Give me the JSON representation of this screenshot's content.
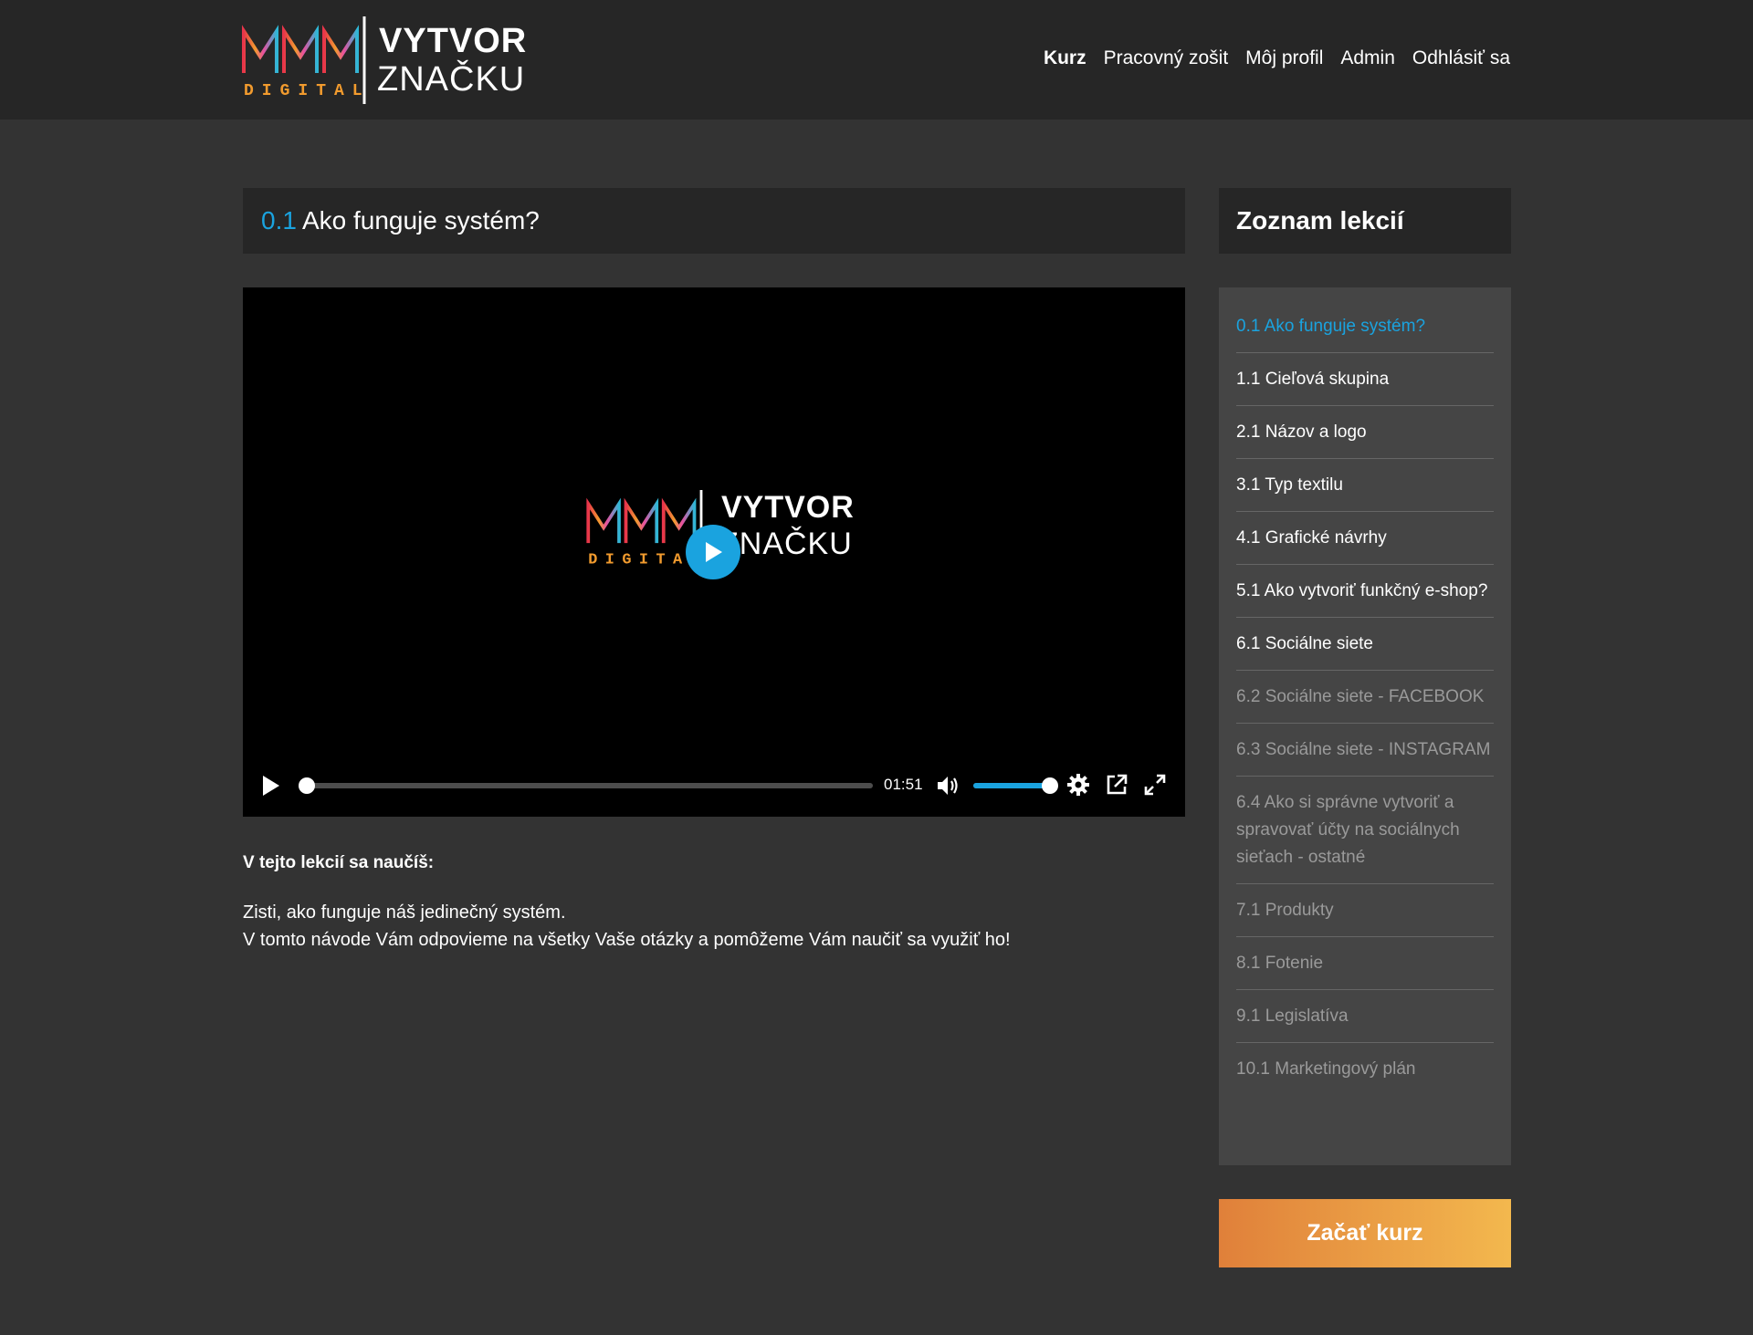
{
  "header": {
    "logo": {
      "mark_letters": "DIGITAL",
      "word1": "VYTVOR",
      "word2": "ZNAČKU"
    },
    "nav": [
      {
        "label": "Kurz",
        "active": true
      },
      {
        "label": "Pracovný zošit",
        "active": false
      },
      {
        "label": "Môj profil",
        "active": false
      },
      {
        "label": "Admin",
        "active": false
      },
      {
        "label": "Odhlásiť sa",
        "active": false
      }
    ]
  },
  "lesson": {
    "number": "0.1",
    "title": "Ako funguje systém?"
  },
  "video": {
    "overlay_logo": {
      "mark_letters": "DIGITAL",
      "word1": "VYTVOR",
      "word2": "ZNAČKU"
    },
    "time": "01:51",
    "progress_fraction": 0.0,
    "volume_fraction": 1.0,
    "icons": {
      "big_play": "play-icon",
      "play": "play-icon",
      "volume": "volume-icon",
      "settings": "gear-icon",
      "popout": "external-link-icon",
      "fullscreen": "fullscreen-icon"
    }
  },
  "description": {
    "heading": "V tejto lekcií sa naučíš:",
    "line1": "Zisti, ako funguje náš jedinečný systém.",
    "line2": "V tomto návode Vám odpovieme na všetky Vaše otázky a pomôžeme Vám naučiť sa využiť ho!"
  },
  "sidebar": {
    "title": "Zoznam lekcií",
    "lessons": [
      {
        "label": "0.1 Ako funguje systém?",
        "state": "current"
      },
      {
        "label": "1.1 Cieľová skupina",
        "state": "available"
      },
      {
        "label": "2.1 Názov a logo",
        "state": "available"
      },
      {
        "label": "3.1 Typ textilu",
        "state": "available"
      },
      {
        "label": "4.1 Grafické návrhy",
        "state": "available"
      },
      {
        "label": "5.1 Ako vytvoriť funkčný e-shop?",
        "state": "available"
      },
      {
        "label": "6.1 Sociálne siete",
        "state": "available"
      },
      {
        "label": "6.2 Sociálne siete - FACEBOOK",
        "state": "locked"
      },
      {
        "label": "6.3 Sociálne siete - INSTAGRAM",
        "state": "locked"
      },
      {
        "label": "6.4 Ako si správne vytvoriť a spravovať účty na sociálnych sieťach - ostatné",
        "state": "locked"
      },
      {
        "label": "7.1 Produkty",
        "state": "locked"
      },
      {
        "label": "8.1 Fotenie",
        "state": "locked"
      },
      {
        "label": "9.1 Legislatíva",
        "state": "locked"
      },
      {
        "label": "10.1 Marketingový plán",
        "state": "locked"
      }
    ],
    "start_button": "Začať kurz"
  },
  "colors": {
    "accent": "#1aa3df",
    "background": "#333333",
    "header": "#262626",
    "panel": "#454545",
    "button_start": "#e0803a",
    "button_end": "#f3b84e"
  }
}
